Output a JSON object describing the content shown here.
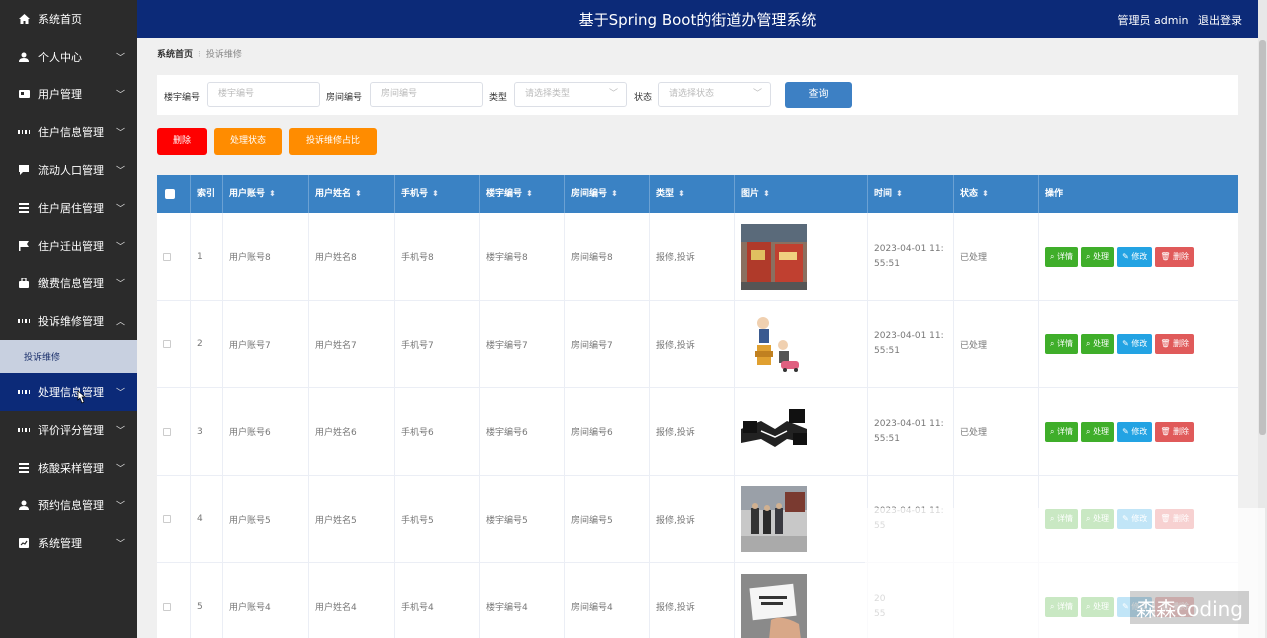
{
  "header": {
    "title": "基于Spring Boot的街道办管理系统",
    "user": "管理员 admin",
    "logout": "退出登录"
  },
  "sidebar": {
    "items": [
      {
        "label": "系统首页",
        "icon": "home-icon",
        "chevron": false
      },
      {
        "label": "个人中心",
        "icon": "person-icon",
        "chevron": true
      },
      {
        "label": "用户管理",
        "icon": "card-icon",
        "chevron": true
      },
      {
        "label": "住户信息管理",
        "icon": "grid-icon",
        "chevron": true
      },
      {
        "label": "流动人口管理",
        "icon": "chat-icon",
        "chevron": true
      },
      {
        "label": "住户居住管理",
        "icon": "list-icon",
        "chevron": true
      },
      {
        "label": "住户迁出管理",
        "icon": "flag-icon",
        "chevron": true
      },
      {
        "label": "缴费信息管理",
        "icon": "bag-icon",
        "chevron": true
      },
      {
        "label": "投诉维修管理",
        "icon": "grid-icon",
        "chevron": true,
        "expanded": true
      },
      {
        "label": "处理信息管理",
        "icon": "grid-icon",
        "chevron": true,
        "hover": true
      },
      {
        "label": "评价评分管理",
        "icon": "grid-icon",
        "chevron": true
      },
      {
        "label": "核酸采样管理",
        "icon": "list-icon",
        "chevron": true
      },
      {
        "label": "预约信息管理",
        "icon": "person-icon",
        "chevron": true
      },
      {
        "label": "系统管理",
        "icon": "chart-icon",
        "chevron": true
      }
    ],
    "sub_item": "投诉维修"
  },
  "breadcrumb": {
    "home": "系统首页",
    "current": "投诉维修"
  },
  "search": {
    "building_label": "楼宇编号",
    "building_placeholder": "楼宇编号",
    "room_label": "房间编号",
    "room_placeholder": "房间编号",
    "type_label": "类型",
    "type_placeholder": "请选择类型",
    "status_label": "状态",
    "status_placeholder": "请选择状态",
    "query": "查询"
  },
  "actions": {
    "delete": "删除",
    "status": "处理状态",
    "ratio": "投诉维修占比"
  },
  "table": {
    "headers": [
      "索引",
      "用户账号",
      "用户姓名",
      "手机号",
      "楼宇编号",
      "房间编号",
      "类型",
      "图片",
      "时间",
      "状态",
      "操作"
    ],
    "ops": {
      "detail": "详情",
      "handle": "处理",
      "edit": "修改",
      "del": "删除"
    },
    "rows": [
      {
        "idx": "1",
        "account": "用户账号8",
        "name": "用户姓名8",
        "phone": "手机号8",
        "building": "楼宇编号8",
        "room": "房间编号8",
        "type": "报修,投诉",
        "time1": "2023-04-01 11:",
        "time2": "55:51",
        "status": "已处理",
        "img": "shop-photo"
      },
      {
        "idx": "2",
        "account": "用户账号7",
        "name": "用户姓名7",
        "phone": "手机号7",
        "building": "楼宇编号7",
        "room": "房间编号7",
        "type": "报修,投诉",
        "time1": "2023-04-01 11:",
        "time2": "55:51",
        "status": "已处理",
        "img": "cartoon"
      },
      {
        "idx": "3",
        "account": "用户账号6",
        "name": "用户姓名6",
        "phone": "手机号6",
        "building": "楼宇编号6",
        "room": "房间编号6",
        "type": "报修,投诉",
        "time1": "2023-04-01 11:",
        "time2": "55:51",
        "status": "已处理",
        "img": "handshake"
      },
      {
        "idx": "4",
        "account": "用户账号5",
        "name": "用户姓名5",
        "phone": "手机号5",
        "building": "楼宇编号5",
        "room": "房间编号5",
        "type": "报修,投诉",
        "time1": "2023-04-01 11:",
        "time2": "55",
        "status": "",
        "img": "street-photo"
      },
      {
        "idx": "5",
        "account": "用户账号4",
        "name": "用户姓名4",
        "phone": "手机号4",
        "building": "楼宇编号4",
        "room": "房间编号4",
        "type": "报修,投诉",
        "time1": "20",
        "time2": "55",
        "status": "",
        "img": "card-photo"
      }
    ]
  },
  "watermark": "森森coding",
  "colors": {
    "header": "#0c2a78",
    "sidebar": "#2b2b2b",
    "table_head": "#3a82c4",
    "delete": "#ff0000",
    "orange": "#ff8c00",
    "green": "#3fae2a",
    "blue": "#23a3e3",
    "red": "#e05a5a"
  }
}
